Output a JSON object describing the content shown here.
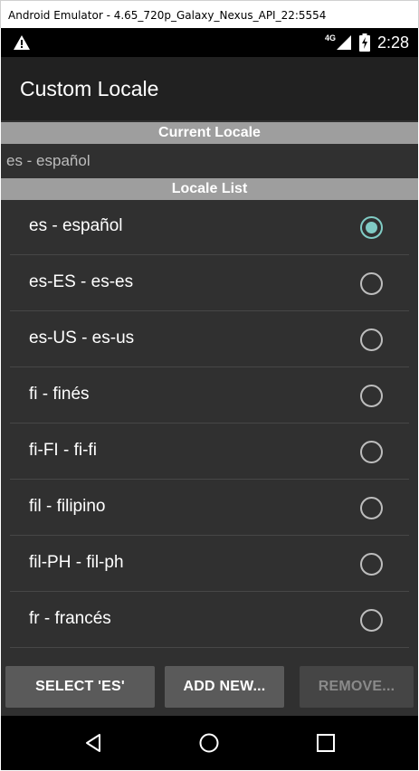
{
  "window": {
    "title": "Android Emulator - 4.65_720p_Galaxy_Nexus_API_22:5554"
  },
  "statusbar": {
    "network_type": "4G",
    "time": "2:28"
  },
  "appbar": {
    "title": "Custom Locale"
  },
  "current_locale": {
    "header": "Current Locale",
    "value": "es - español"
  },
  "locale_list": {
    "header": "Locale List",
    "items": [
      {
        "label": "es - español",
        "selected": true
      },
      {
        "label": "es-ES - es-es",
        "selected": false
      },
      {
        "label": "es-US - es-us",
        "selected": false
      },
      {
        "label": "fi - finés",
        "selected": false
      },
      {
        "label": "fi-FI - fi-fi",
        "selected": false
      },
      {
        "label": "fil - filipino",
        "selected": false
      },
      {
        "label": "fil-PH - fil-ph",
        "selected": false
      },
      {
        "label": "fr - francés",
        "selected": false
      }
    ]
  },
  "buttons": {
    "select": "SELECT 'ES'",
    "add_new": "ADD NEW...",
    "remove": "REMOVE..."
  },
  "colors": {
    "accent": "#80cbc4",
    "background": "#303030",
    "appbar": "#212121",
    "header": "#9e9e9e"
  },
  "icons": [
    "warning-icon",
    "signal-icon",
    "battery-icon",
    "back-icon",
    "home-icon",
    "recents-icon"
  ]
}
